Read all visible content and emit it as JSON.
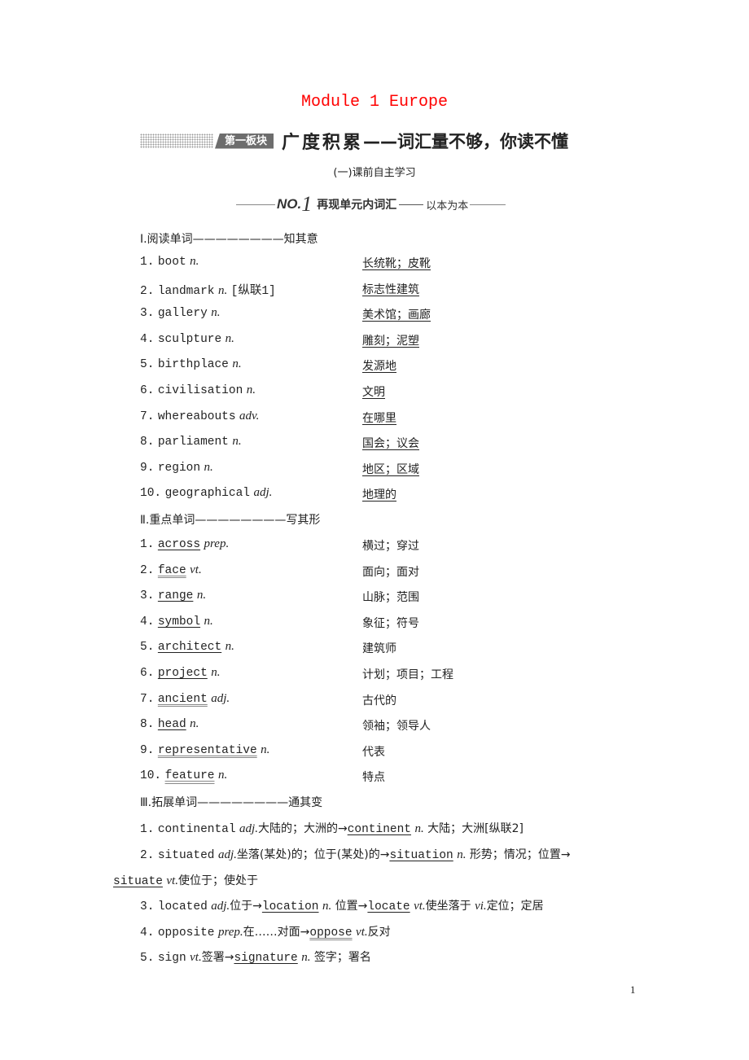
{
  "title": "Module 1 Europe",
  "banner": {
    "tag": "第一板块",
    "heading": "广度积累",
    "subheading": "——词汇量不够，你读不懂"
  },
  "subtitle": "(一)课前自主学习",
  "no1": {
    "label": "NO.",
    "number": "1",
    "heading": "再现单元内词汇",
    "subheading": "以本为本"
  },
  "section1": {
    "heading": "Ⅰ.阅读单词————————知其意",
    "items": [
      {
        "num": "1.",
        "word": "boot",
        "pos": "n.",
        "note": "",
        "meaning": "长统靴；皮靴"
      },
      {
        "num": "2.",
        "word": "landmark",
        "pos": "n.",
        "note": "[纵联1]",
        "meaning": "标志性建筑"
      },
      {
        "num": "3.",
        "word": "gallery",
        "pos": "n.",
        "note": "",
        "meaning": "美术馆；画廊"
      },
      {
        "num": "4.",
        "word": "sculpture",
        "pos": "n.",
        "note": "",
        "meaning": "雕刻；泥塑"
      },
      {
        "num": "5.",
        "word": "birthplace",
        "pos": "n.",
        "note": "",
        "meaning": "发源地"
      },
      {
        "num": "6.",
        "word": "civilisation",
        "pos": "n.",
        "note": "",
        "meaning": "文明"
      },
      {
        "num": "7.",
        "word": "whereabouts",
        "pos": "adv.",
        "note": "",
        "meaning": "在哪里"
      },
      {
        "num": "8.",
        "word": "parliament",
        "pos": "n.",
        "note": "",
        "meaning": "国会；议会"
      },
      {
        "num": "9.",
        "word": "region",
        "pos": "n.",
        "note": "",
        "meaning": "地区；区域"
      },
      {
        "num": "10.",
        "word": "geographical",
        "pos": "adj.",
        "note": "",
        "meaning": "地理的"
      }
    ]
  },
  "section2": {
    "heading": "Ⅱ.重点单词————————写其形",
    "items": [
      {
        "num": "1.",
        "word": "across",
        "pos": "prep.",
        "meaning": "横过；穿过"
      },
      {
        "num": "2.",
        "word": "face",
        "pos": "vt.",
        "meaning": "面向；面对"
      },
      {
        "num": "3.",
        "word": "range",
        "pos": "n.",
        "meaning": "山脉；范围"
      },
      {
        "num": "4.",
        "word": "symbol",
        "pos": "n.",
        "meaning": "象征；符号"
      },
      {
        "num": "5.",
        "word": "architect",
        "pos": "n.",
        "meaning": "建筑师"
      },
      {
        "num": "6.",
        "word": "project",
        "pos": "n.",
        "meaning": "计划；项目；工程"
      },
      {
        "num": "7.",
        "word": "ancient",
        "pos": "adj.",
        "meaning": "古代的"
      },
      {
        "num": "8.",
        "word": "head",
        "pos": "n.",
        "meaning": "领袖；领导人"
      },
      {
        "num": "9.",
        "word": "representative",
        "pos": "n.",
        "meaning": "代表"
      },
      {
        "num": "10.",
        "word": "feature",
        "pos": "n.",
        "meaning": "特点"
      }
    ]
  },
  "section3": {
    "heading": "Ⅲ.拓展单词————————通其变",
    "items": [
      {
        "num": "1.",
        "base": "continental",
        "base_pos": "adj.",
        "base_meaning": "大陆的；大洲的→",
        "derived": "continent",
        "derived_pos": "n.",
        "derived_meaning": "大陆；大洲[纵联2]"
      },
      {
        "num": "2.",
        "base": "situated",
        "base_pos": "adj.",
        "base_meaning": "坐落(某处)的；位于(某处)的→",
        "derived": "situation",
        "derived_pos": "n.",
        "derived_meaning": "形势；情况；位置→",
        "derived2": "situate",
        "derived2_pos": "vt.",
        "derived2_meaning": "使位于；使处于"
      },
      {
        "num": "3.",
        "base": "located",
        "base_pos": "adj.",
        "base_meaning": "位于→",
        "derived": "location",
        "derived_pos": "n.",
        "derived_meaning": "位置→",
        "derived2": "locate",
        "derived2_pos": "vt.",
        "derived2_meaning": "使坐落于",
        "derived3_pos": "vi.",
        "derived3_meaning": "定位；定居"
      },
      {
        "num": "4.",
        "base": "opposite",
        "base_pos": "prep.",
        "base_meaning": "在……对面→",
        "derived": "oppose",
        "derived_pos": "vt.",
        "derived_meaning": "反对"
      },
      {
        "num": "5.",
        "base": "sign",
        "base_pos": "vt.",
        "base_meaning": "签署→",
        "derived": "signature",
        "derived_pos": "n.",
        "derived_meaning": "签字；署名"
      }
    ]
  },
  "page_number": "1"
}
